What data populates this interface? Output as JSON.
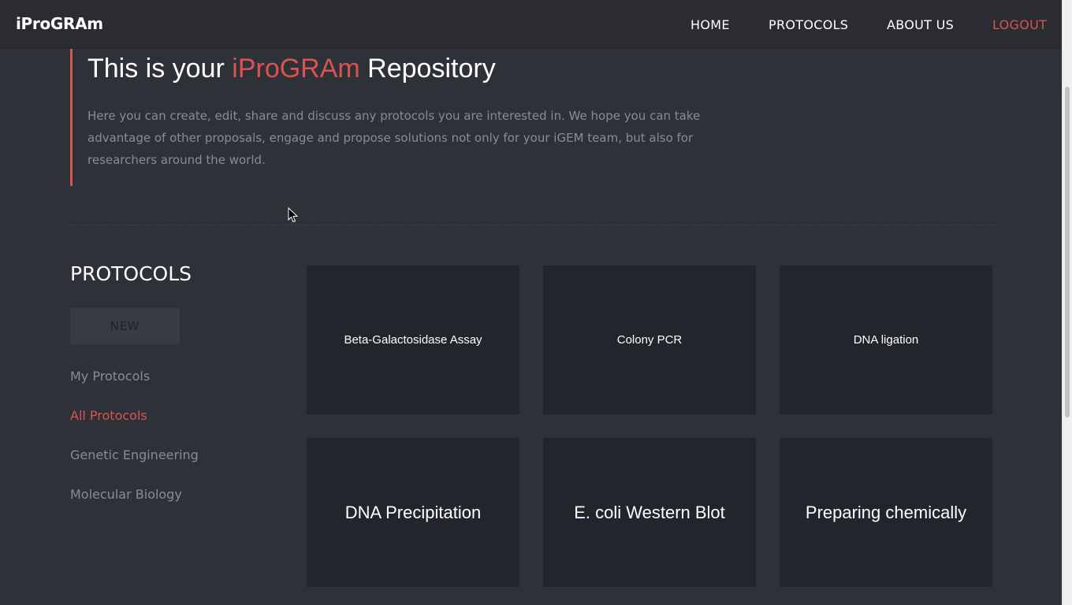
{
  "navbar": {
    "brand": "iProGRAm",
    "links": {
      "home": "HOME",
      "protocols": "PROTOCOLS",
      "about": "ABOUT US",
      "logout": "LOGOUT"
    }
  },
  "hero": {
    "title_prefix": "This is your ",
    "title_accent": "iProGRAm",
    "title_suffix": " Repository",
    "text": "Here you can create, edit, share and discuss any protocols you are interested in. We hope you can take advantage of other proposals, engage and propose solutions not only for your iGEM team, but also for researchers around the world."
  },
  "sidebar": {
    "title": "PROTOCOLS",
    "new_label": "NEW",
    "items": [
      {
        "label": "My Protocols"
      },
      {
        "label": "All Protocols"
      },
      {
        "label": "Genetic Engineering"
      },
      {
        "label": "Molecular Biology"
      }
    ]
  },
  "cards": [
    {
      "title": "Beta-Galactosidase Assay"
    },
    {
      "title": "Colony PCR"
    },
    {
      "title": "DNA ligation"
    },
    {
      "title": "DNA Precipitation"
    },
    {
      "title": "E. coli Western Blot"
    },
    {
      "title": "Preparing chemically"
    }
  ],
  "colors": {
    "accent": "#d9534f",
    "background": "#2f3139",
    "navbar": "#2a2c32",
    "card": "#22252b"
  }
}
